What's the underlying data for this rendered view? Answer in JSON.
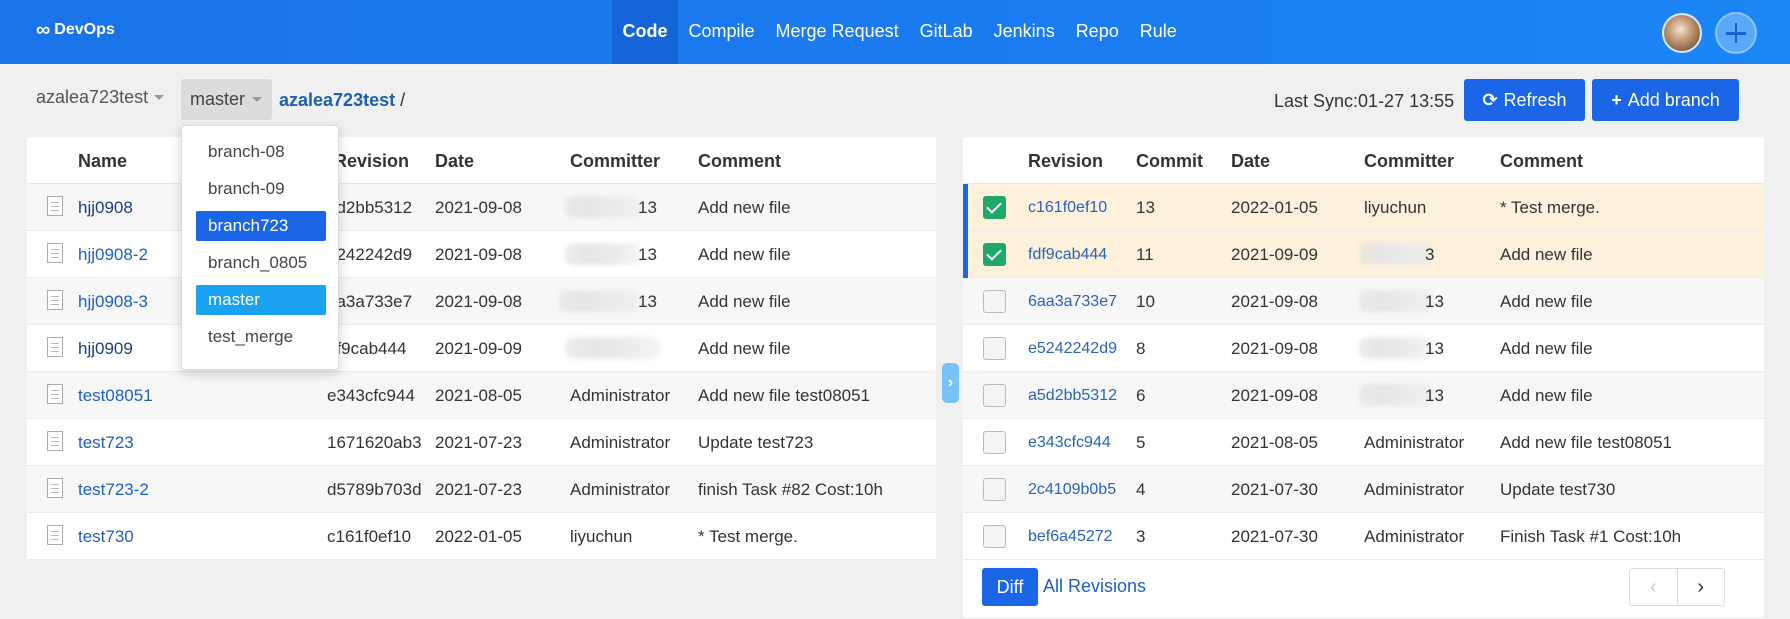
{
  "header": {
    "logo": "DevOps",
    "nav": [
      "Code",
      "Compile",
      "Merge Request",
      "GitLab",
      "Jenkins",
      "Repo",
      "Rule"
    ],
    "active_nav": "Code"
  },
  "toolbar": {
    "repo": "azalea723test",
    "branch": "master",
    "breadcrumb_repo": "azalea723test",
    "breadcrumb_sep": "/",
    "last_sync": "Last Sync:01-27 13:55",
    "refresh_label": "Refresh",
    "add_branch_label": "Add branch"
  },
  "branch_dropdown": {
    "items": [
      "branch-08",
      "branch-09",
      "branch723",
      "branch_0805",
      "master",
      "test_merge"
    ],
    "hovered": "branch723",
    "selected": "master"
  },
  "files": {
    "columns": [
      "Name",
      "Revision",
      "Date",
      "Committer",
      "Comment"
    ],
    "rows": [
      {
        "name": "hjj0908",
        "revision": "5d2bb5312",
        "date": "2021-09-08",
        "committer": "13",
        "comment": "Add new file"
      },
      {
        "name": "hjj0908-2",
        "revision": "5242242d9",
        "date": "2021-09-08",
        "committer": "13",
        "comment": "Add new file"
      },
      {
        "name": "hjj0908-3",
        "revision": "aa3a733e7",
        "date": "2021-09-08",
        "committer": "13",
        "comment": "Add new file"
      },
      {
        "name": "hjj0909",
        "revision": "df9cab444",
        "date": "2021-09-09",
        "committer": "",
        "comment": "Add new file"
      },
      {
        "name": "test08051",
        "revision": "e343cfc944",
        "date": "2021-08-05",
        "committer": "Administrator",
        "comment": "Add new file test08051"
      },
      {
        "name": "test723",
        "revision": "1671620ab3",
        "date": "2021-07-23",
        "committer": "Administrator",
        "comment": "Update test723"
      },
      {
        "name": "test723-2",
        "revision": "d5789b703d",
        "date": "2021-07-23",
        "committer": "Administrator",
        "comment": "finish Task #82 Cost:10h"
      },
      {
        "name": "test730",
        "revision": "c161f0ef10",
        "date": "2022-01-05",
        "committer": "liyuchun",
        "comment": "* Test merge."
      }
    ]
  },
  "revisions": {
    "columns": [
      "Revision",
      "Commit",
      "Date",
      "Committer",
      "Comment"
    ],
    "rows": [
      {
        "revision": "c161f0ef10",
        "commit": "13",
        "date": "2022-01-05",
        "committer": "liyuchun",
        "comment": "* Test merge.",
        "checked": true
      },
      {
        "revision": "fdf9cab444",
        "commit": "11",
        "date": "2021-09-09",
        "committer": "3",
        "comment": "Add new file",
        "checked": true
      },
      {
        "revision": "6aa3a733e7",
        "commit": "10",
        "date": "2021-09-08",
        "committer": "13",
        "comment": "Add new file",
        "checked": false
      },
      {
        "revision": "e5242242d9",
        "commit": "8",
        "date": "2021-09-08",
        "committer": "13",
        "comment": "Add new file",
        "checked": false
      },
      {
        "revision": "a5d2bb5312",
        "commit": "6",
        "date": "2021-09-08",
        "committer": "13",
        "comment": "Add new file",
        "checked": false
      },
      {
        "revision": "e343cfc944",
        "commit": "5",
        "date": "2021-08-05",
        "committer": "Administrator",
        "comment": "Add new file test08051",
        "checked": false
      },
      {
        "revision": "2c4109b0b5",
        "commit": "4",
        "date": "2021-07-30",
        "committer": "Administrator",
        "comment": "Update test730",
        "checked": false
      },
      {
        "revision": "bef6a45272",
        "commit": "3",
        "date": "2021-07-30",
        "committer": "Administrator",
        "comment": "Finish Task #1 Cost:10h",
        "checked": false
      }
    ],
    "diff_label": "Diff",
    "all_revisions_label": "All Revisions",
    "prev_icon": "‹",
    "next_icon": "›"
  },
  "colors": {
    "primary": "#1a66e6",
    "header_bg": "#1a73e8",
    "selected_row": "#fdf1dc",
    "checkbox_on": "#1ea86a",
    "link": "#1e5fc4"
  }
}
